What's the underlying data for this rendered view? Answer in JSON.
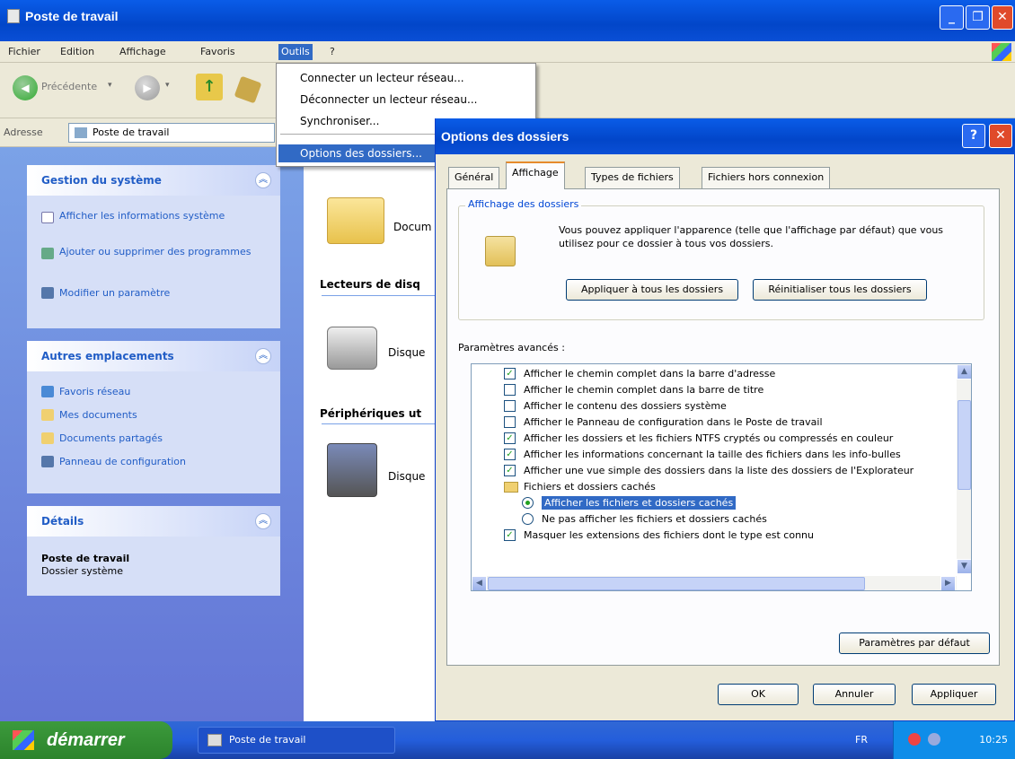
{
  "window": {
    "title": "Poste de travail"
  },
  "menubar": {
    "items": [
      "Fichier",
      "Edition",
      "Affichage",
      "Favoris",
      "Outils",
      "?"
    ]
  },
  "toolbar": {
    "back_label": "Précédente"
  },
  "address": {
    "label": "Adresse",
    "value": "Poste de travail"
  },
  "tasks": {
    "system": {
      "title": "Gestion du système",
      "items": [
        "Afficher les informations système",
        "Ajouter ou supprimer des programmes",
        "Modifier un paramètre"
      ]
    },
    "places": {
      "title": "Autres emplacements",
      "items": [
        "Favoris réseau",
        "Mes documents",
        "Documents partagés",
        "Panneau de configuration"
      ]
    },
    "details": {
      "title": "Détails",
      "name": "Poste de travail",
      "type": "Dossier système"
    }
  },
  "content": {
    "docs_label": "Docum",
    "drives_header": "Lecteurs de disq",
    "drive_label": "Disque",
    "removable_header": "Périphériques ut",
    "removable_label": "Disque"
  },
  "tools_menu": {
    "items": [
      "Connecter un lecteur réseau...",
      "Déconnecter un lecteur réseau...",
      "Synchroniser...",
      "Options des dossiers..."
    ]
  },
  "dialog": {
    "title": "Options des dossiers",
    "tabs": [
      "Général",
      "Affichage",
      "Types de fichiers",
      "Fichiers hors connexion"
    ],
    "folder_view": {
      "title": "Affichage des dossiers",
      "description": "Vous pouvez appliquer l'apparence (telle que l'affichage par défaut) que vous utilisez pour ce dossier à tous vos dossiers.",
      "apply_all": "Appliquer à tous les dossiers",
      "reset_all": "Réinitialiser tous les dossiers"
    },
    "advanced": {
      "title": "Paramètres avancés :",
      "items": [
        {
          "kind": "checkbox",
          "checked": true,
          "label": "Afficher le chemin complet dans la barre d'adresse"
        },
        {
          "kind": "checkbox",
          "checked": false,
          "label": "Afficher le chemin complet dans la barre de titre"
        },
        {
          "kind": "checkbox",
          "checked": false,
          "label": "Afficher le contenu des dossiers système"
        },
        {
          "kind": "checkbox",
          "checked": false,
          "label": "Afficher le Panneau de configuration dans le Poste de travail"
        },
        {
          "kind": "checkbox",
          "checked": true,
          "label": "Afficher les dossiers et les fichiers NTFS cryptés ou compressés en couleur"
        },
        {
          "kind": "checkbox",
          "checked": true,
          "label": "Afficher les informations concernant la taille des fichiers dans les info-bulles"
        },
        {
          "kind": "checkbox",
          "checked": true,
          "label": "Afficher une vue simple des dossiers dans la liste des dossiers de l'Explorateur"
        },
        {
          "kind": "folder",
          "label": "Fichiers et dossiers cachés"
        },
        {
          "kind": "radio",
          "checked": true,
          "label": "Afficher les fichiers et dossiers cachés"
        },
        {
          "kind": "radio",
          "checked": false,
          "label": "Ne pas afficher les fichiers et dossiers cachés"
        },
        {
          "kind": "checkbox",
          "checked": true,
          "label": "Masquer les extensions des fichiers dont le type est connu"
        }
      ]
    },
    "defaults": "Paramètres par défaut",
    "ok": "OK",
    "cancel": "Annuler",
    "apply": "Appliquer"
  },
  "taskbar": {
    "start": "démarrer",
    "task": "Poste de travail",
    "lang": "FR",
    "clock": "10:25"
  },
  "colors": {
    "xp_blue": "#0a5ce8",
    "task_blue": "#215dc6",
    "selection": "#316ac5",
    "start_green": "#3c9a3c"
  }
}
